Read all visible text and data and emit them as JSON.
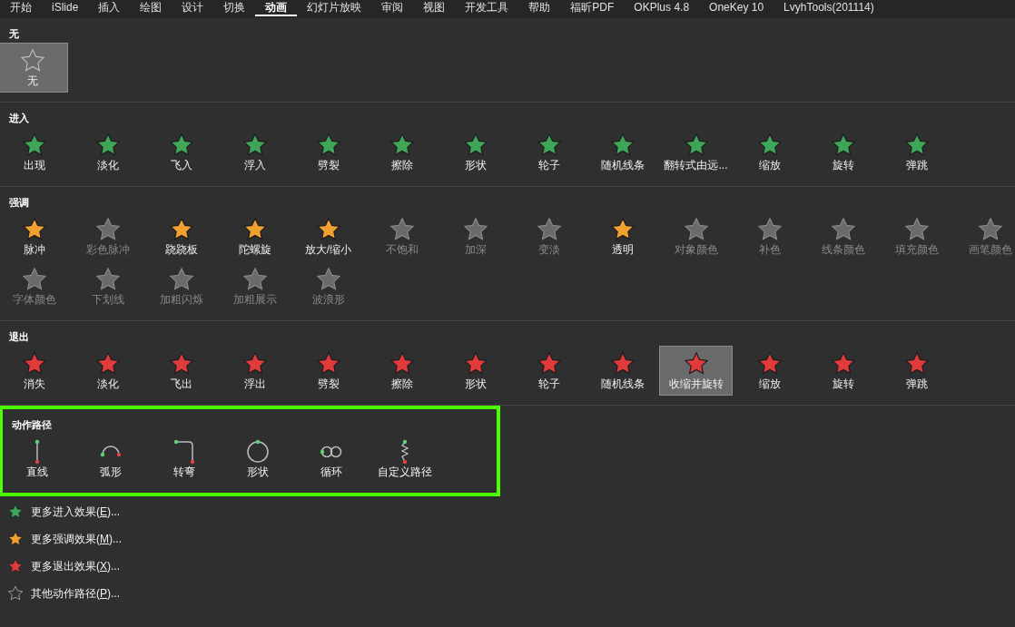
{
  "tabs": [
    {
      "label": "开始",
      "selected": false
    },
    {
      "label": "iSlide",
      "selected": false
    },
    {
      "label": "插入",
      "selected": false
    },
    {
      "label": "绘图",
      "selected": false
    },
    {
      "label": "设计",
      "selected": false
    },
    {
      "label": "切换",
      "selected": false
    },
    {
      "label": "动画",
      "selected": true
    },
    {
      "label": "幻灯片放映",
      "selected": false
    },
    {
      "label": "审阅",
      "selected": false
    },
    {
      "label": "视图",
      "selected": false
    },
    {
      "label": "开发工具",
      "selected": false
    },
    {
      "label": "帮助",
      "selected": false
    },
    {
      "label": "福昕PDF",
      "selected": false
    },
    {
      "label": "OKPlus 4.8",
      "selected": false
    },
    {
      "label": "OneKey 10",
      "selected": false
    },
    {
      "label": "LvyhTools(201114)",
      "selected": false
    }
  ],
  "sections": [
    {
      "title": "无",
      "kind": "none",
      "highlighted": false,
      "items": [
        {
          "label": "无",
          "selected": true,
          "disabled": false
        }
      ]
    },
    {
      "title": "进入",
      "kind": "entrance",
      "highlighted": false,
      "items": [
        {
          "label": "出现",
          "selected": false,
          "disabled": false
        },
        {
          "label": "淡化",
          "selected": false,
          "disabled": false
        },
        {
          "label": "飞入",
          "selected": false,
          "disabled": false
        },
        {
          "label": "浮入",
          "selected": false,
          "disabled": false
        },
        {
          "label": "劈裂",
          "selected": false,
          "disabled": false
        },
        {
          "label": "擦除",
          "selected": false,
          "disabled": false
        },
        {
          "label": "形状",
          "selected": false,
          "disabled": false
        },
        {
          "label": "轮子",
          "selected": false,
          "disabled": false
        },
        {
          "label": "随机线条",
          "selected": false,
          "disabled": false
        },
        {
          "label": "翻转式由远...",
          "selected": false,
          "disabled": false
        },
        {
          "label": "缩放",
          "selected": false,
          "disabled": false
        },
        {
          "label": "旋转",
          "selected": false,
          "disabled": false
        },
        {
          "label": "弹跳",
          "selected": false,
          "disabled": false
        }
      ]
    },
    {
      "title": "强调",
      "kind": "emphasis",
      "highlighted": false,
      "items": [
        {
          "label": "脉冲",
          "selected": false,
          "disabled": false
        },
        {
          "label": "彩色脉冲",
          "selected": false,
          "disabled": true
        },
        {
          "label": "跷跷板",
          "selected": false,
          "disabled": false
        },
        {
          "label": "陀螺旋",
          "selected": false,
          "disabled": false
        },
        {
          "label": "放大/缩小",
          "selected": false,
          "disabled": false
        },
        {
          "label": "不饱和",
          "selected": false,
          "disabled": true
        },
        {
          "label": "加深",
          "selected": false,
          "disabled": true
        },
        {
          "label": "变淡",
          "selected": false,
          "disabled": true
        },
        {
          "label": "透明",
          "selected": false,
          "disabled": false
        },
        {
          "label": "对象颜色",
          "selected": false,
          "disabled": true
        },
        {
          "label": "补色",
          "selected": false,
          "disabled": true
        },
        {
          "label": "线条颜色",
          "selected": false,
          "disabled": true
        },
        {
          "label": "填充颜色",
          "selected": false,
          "disabled": true
        },
        {
          "label": "画笔颜色",
          "selected": false,
          "disabled": true
        },
        {
          "label": "字体颜色",
          "selected": false,
          "disabled": true
        },
        {
          "label": "下划线",
          "selected": false,
          "disabled": true
        },
        {
          "label": "加粗闪烁",
          "selected": false,
          "disabled": true
        },
        {
          "label": "加粗展示",
          "selected": false,
          "disabled": true
        },
        {
          "label": "波浪形",
          "selected": false,
          "disabled": true
        }
      ]
    },
    {
      "title": "退出",
      "kind": "exit",
      "highlighted": false,
      "items": [
        {
          "label": "消失",
          "selected": false,
          "disabled": false
        },
        {
          "label": "淡化",
          "selected": false,
          "disabled": false
        },
        {
          "label": "飞出",
          "selected": false,
          "disabled": false
        },
        {
          "label": "浮出",
          "selected": false,
          "disabled": false
        },
        {
          "label": "劈裂",
          "selected": false,
          "disabled": false
        },
        {
          "label": "擦除",
          "selected": false,
          "disabled": false
        },
        {
          "label": "形状",
          "selected": false,
          "disabled": false
        },
        {
          "label": "轮子",
          "selected": false,
          "disabled": false
        },
        {
          "label": "随机线条",
          "selected": false,
          "disabled": false
        },
        {
          "label": "收缩并旋转",
          "selected": true,
          "disabled": false
        },
        {
          "label": "缩放",
          "selected": false,
          "disabled": false
        },
        {
          "label": "旋转",
          "selected": false,
          "disabled": false
        },
        {
          "label": "弹跳",
          "selected": false,
          "disabled": false
        }
      ]
    },
    {
      "title": "动作路径",
      "kind": "path",
      "highlighted": true,
      "items": [
        {
          "label": "直线",
          "kind": "line",
          "selected": false,
          "disabled": false
        },
        {
          "label": "弧形",
          "kind": "arc",
          "selected": false,
          "disabled": false
        },
        {
          "label": "转弯",
          "kind": "turn",
          "selected": false,
          "disabled": false
        },
        {
          "label": "形状",
          "kind": "circle",
          "selected": false,
          "disabled": false
        },
        {
          "label": "循环",
          "kind": "loop",
          "selected": false,
          "disabled": false
        },
        {
          "label": "自定义路径",
          "kind": "custom",
          "selected": false,
          "disabled": false
        }
      ]
    }
  ],
  "menu": [
    {
      "kind": "entrance",
      "text_before": "更多进入效果(",
      "access_key": "E",
      "text_after": ")..."
    },
    {
      "kind": "emphasis",
      "text_before": "更多强调效果(",
      "access_key": "M",
      "text_after": ")..."
    },
    {
      "kind": "exit",
      "text_before": "更多退出效果(",
      "access_key": "X",
      "text_after": ")..."
    },
    {
      "kind": "path",
      "text_before": "其他动作路径(",
      "access_key": "P",
      "text_after": ")..."
    }
  ]
}
